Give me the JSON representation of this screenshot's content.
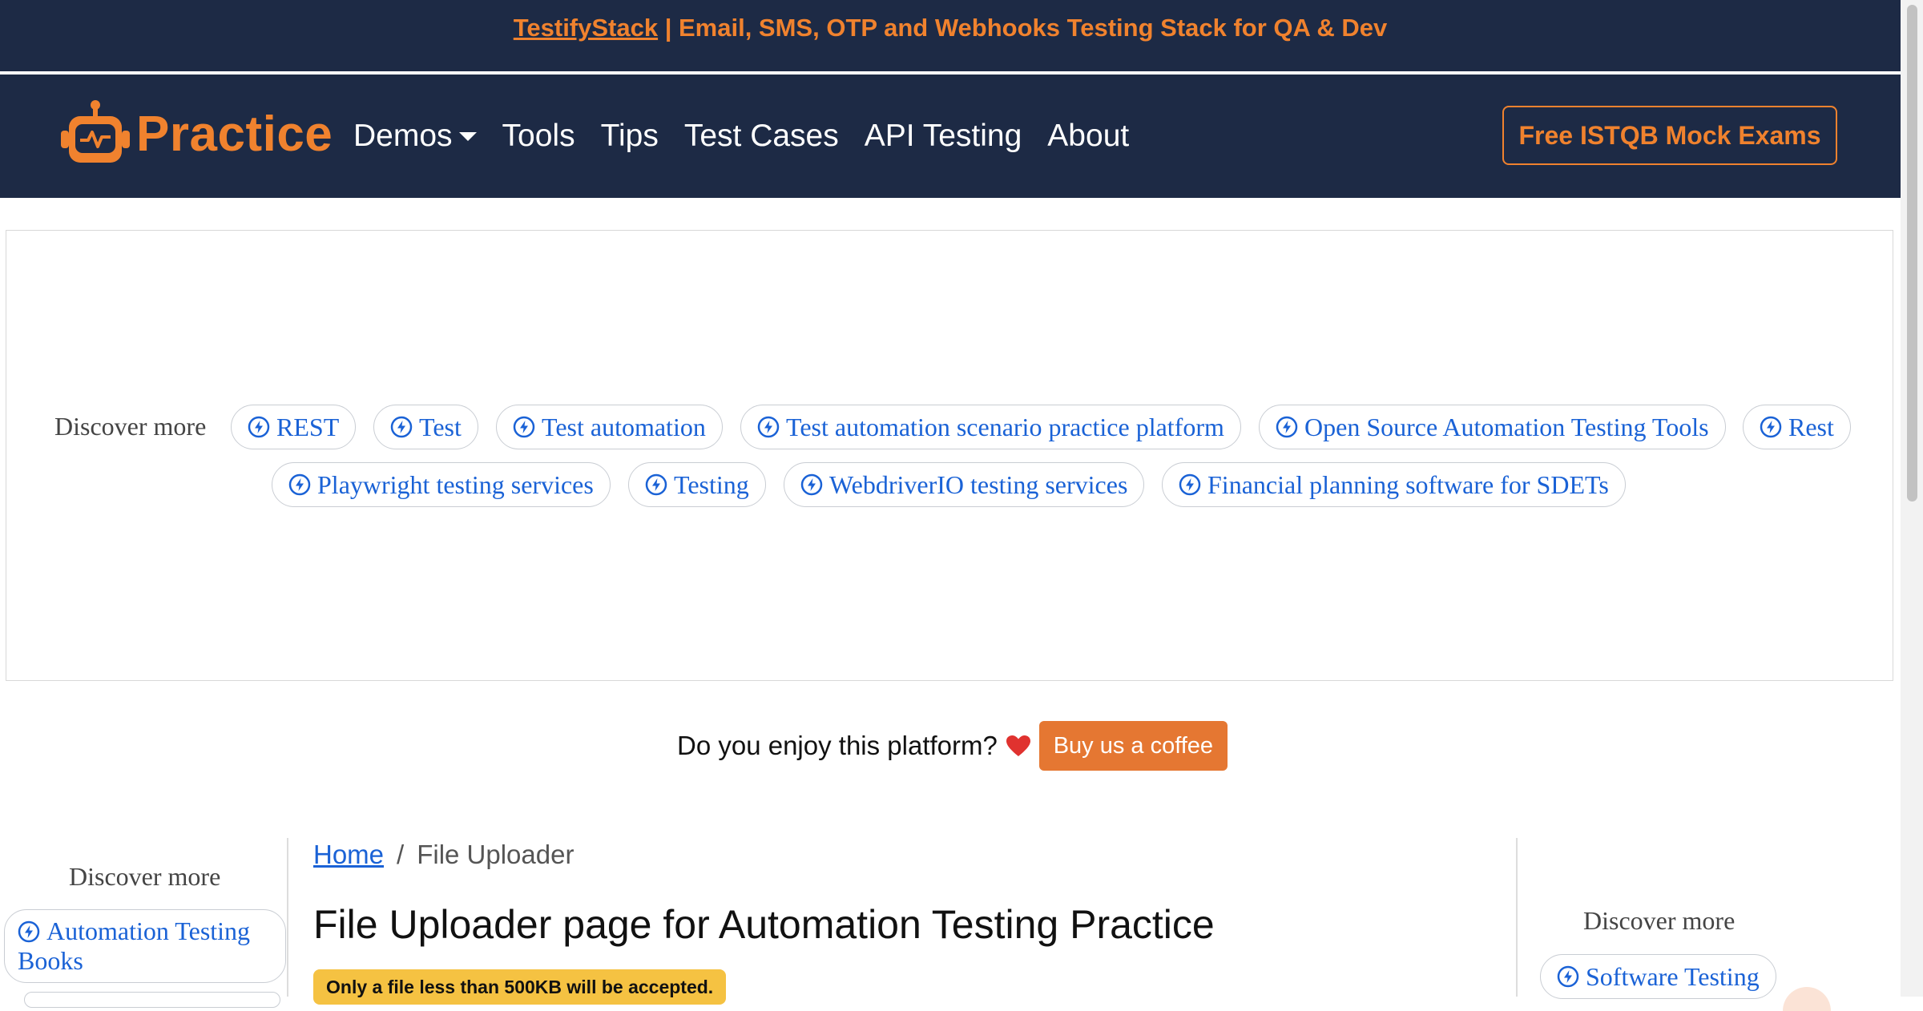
{
  "banner": {
    "link_text": "TestifyStack",
    "rest_text": " | Email, SMS, OTP and Webhooks Testing Stack for QA & Dev"
  },
  "navbar": {
    "brand": "Practice",
    "links": [
      {
        "label": "Demos",
        "has_dropdown": true
      },
      {
        "label": "Tools"
      },
      {
        "label": "Tips"
      },
      {
        "label": "Test Cases"
      },
      {
        "label": "API Testing"
      },
      {
        "label": "About"
      }
    ],
    "cta_label": "Free ISTQB Mock Exams"
  },
  "ad": {
    "discover_label": "Discover more",
    "chips": [
      "REST",
      "Test",
      "Test automation",
      "Test automation scenario practice platform",
      "Open Source Automation Testing Tools",
      "Rest",
      "Playwright testing services",
      "Testing",
      "WebdriverIO testing services",
      "Financial planning software for SDETs"
    ]
  },
  "support": {
    "question": "Do you enjoy this platform?",
    "button_label": "Buy us a coffee"
  },
  "left_sidebar": {
    "discover_label": "Discover more",
    "chips": [
      "Automation Testing Books"
    ]
  },
  "right_sidebar": {
    "discover_label": "Discover more",
    "chips": [
      "Software Testing"
    ]
  },
  "main": {
    "breadcrumb": {
      "home": "Home",
      "separator": "/",
      "current": "File Uploader"
    },
    "title": "File Uploader page for Automation Testing Practice",
    "notice": "Only a file less than 500KB will be accepted."
  },
  "colors": {
    "navy": "#1d2a45",
    "orange": "#f0822e",
    "link_blue": "#1a62d6",
    "coffee": "#e57732",
    "notice_yellow": "#f5c242"
  },
  "icons": {
    "chip_icon": "bolt-circle-icon",
    "brand_icon": "robot-icon",
    "heart_icon": "heart-icon"
  }
}
